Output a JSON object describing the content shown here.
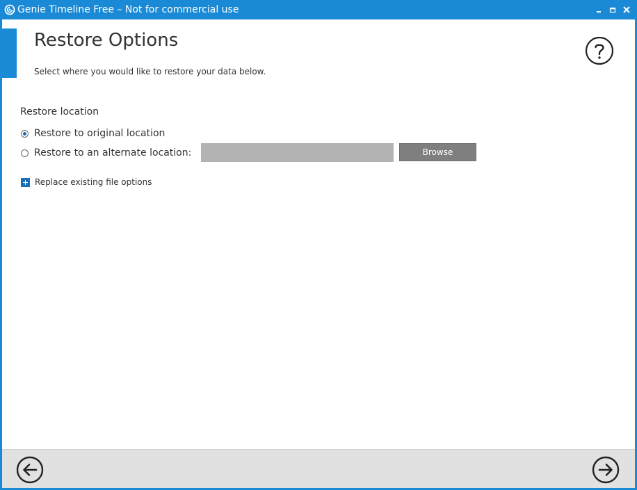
{
  "window": {
    "title": "Genie Timeline Free – Not for commercial use",
    "accent_color": "#1a8ad6"
  },
  "titlebar_buttons": {
    "minimize_icon": "minimize-icon",
    "maximize_icon": "maximize-icon",
    "close_icon": "close-icon"
  },
  "header": {
    "title": "Restore Options",
    "subtitle": "Select where you would like to restore your data below.",
    "help_icon": "question-mark-icon"
  },
  "restore_location": {
    "heading": "Restore location",
    "options": [
      {
        "label": "Restore to original location",
        "selected": true
      },
      {
        "label": "Restore to an alternate location:",
        "selected": false
      }
    ],
    "alternate_path_value": "",
    "browse_label": "Browse"
  },
  "replace_options": {
    "label": "Replace existing file options",
    "expanded": false,
    "icon": "plus-box-icon"
  },
  "footer": {
    "back_icon": "arrow-left-circle-icon",
    "next_icon": "arrow-right-circle-icon"
  }
}
